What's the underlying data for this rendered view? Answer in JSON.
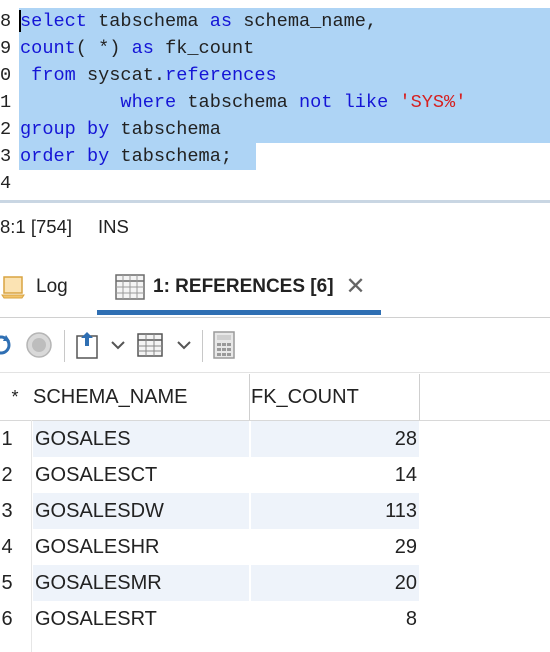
{
  "editor": {
    "lines": [
      {
        "num": "8",
        "tokens": [
          {
            "t": "select",
            "c": "kw"
          },
          {
            "t": " tabschema ",
            "c": "pl"
          },
          {
            "t": "as",
            "c": "kw"
          },
          {
            "t": " schema_name,",
            "c": "pl"
          }
        ]
      },
      {
        "num": "9",
        "tokens": [
          {
            "t": "count",
            "c": "fn"
          },
          {
            "t": "( *) ",
            "c": "pl"
          },
          {
            "t": "as",
            "c": "kw"
          },
          {
            "t": " fk_count",
            "c": "pl"
          }
        ]
      },
      {
        "num": "0",
        "tokens": [
          {
            "t": " from",
            "c": "kw"
          },
          {
            "t": " syscat.",
            "c": "pl"
          },
          {
            "t": "references",
            "c": "kw"
          }
        ]
      },
      {
        "num": "1",
        "tokens": [
          {
            "t": "         where",
            "c": "kw"
          },
          {
            "t": " tabschema ",
            "c": "pl"
          },
          {
            "t": "not like",
            "c": "kw"
          },
          {
            "t": " ",
            "c": "pl"
          },
          {
            "t": "'SYS%'",
            "c": "str"
          }
        ]
      },
      {
        "num": "2",
        "tokens": [
          {
            "t": "group by",
            "c": "kw"
          },
          {
            "t": " tabschema",
            "c": "pl"
          }
        ]
      },
      {
        "num": "3",
        "tokens": [
          {
            "t": "order by",
            "c": "kw"
          },
          {
            "t": " tabschema;",
            "c": "pl"
          }
        ]
      },
      {
        "num": "4",
        "tokens": []
      }
    ]
  },
  "status": {
    "position": "8:1 [754]",
    "mode": "INS"
  },
  "tabs": {
    "log_label": "Log",
    "references_label": "1: REFERENCES [6]",
    "close_glyph": "✕"
  },
  "grid": {
    "star": "*",
    "columns": [
      "SCHEMA_NAME",
      "FK_COUNT"
    ],
    "rows": [
      {
        "num": "1",
        "schema_name": "GOSALES",
        "fk_count": "28"
      },
      {
        "num": "2",
        "schema_name": "GOSALESCT",
        "fk_count": "14"
      },
      {
        "num": "3",
        "schema_name": "GOSALESDW",
        "fk_count": "113"
      },
      {
        "num": "4",
        "schema_name": "GOSALESHR",
        "fk_count": "29"
      },
      {
        "num": "5",
        "schema_name": "GOSALESMR",
        "fk_count": "20"
      },
      {
        "num": "6",
        "schema_name": "GOSALESRT",
        "fk_count": "8"
      }
    ]
  },
  "icons": {
    "log": "log-icon",
    "table": "table-icon",
    "refresh": "refresh-icon",
    "stop": "stop-icon",
    "export": "export-icon",
    "grid": "grid-view-icon",
    "calculator": "calculator-icon"
  },
  "colors": {
    "selection": "#aed4f5",
    "keyword": "#1515d6",
    "string": "#d62020",
    "tab_underline": "#2f6fb3",
    "row_alt": "#eef3fa"
  }
}
